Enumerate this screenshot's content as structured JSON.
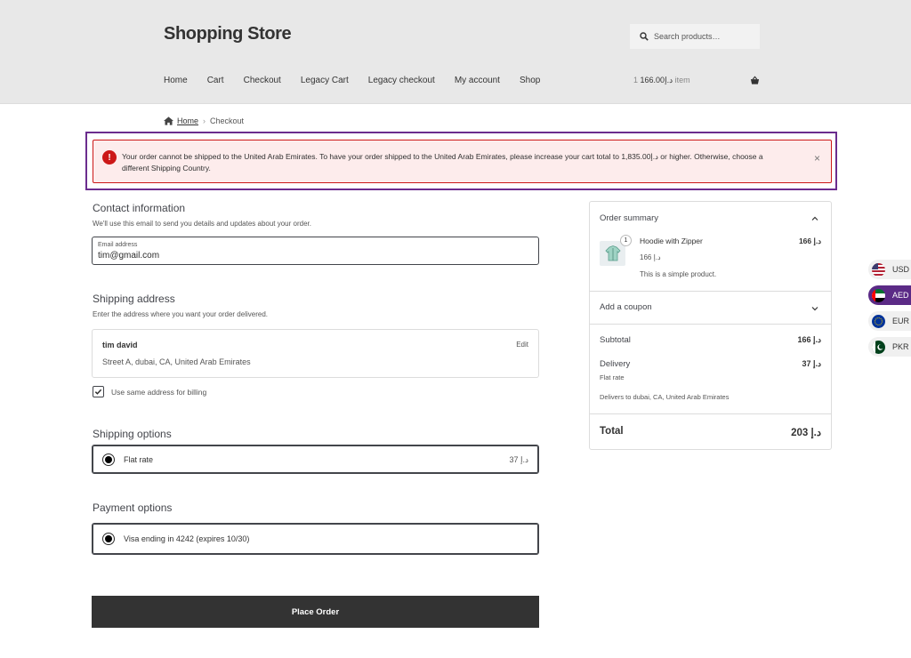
{
  "header": {
    "site_title": "Shopping Store",
    "search_placeholder": "Search products…",
    "nav": [
      "Home",
      "Cart",
      "Checkout",
      "Legacy Cart",
      "Legacy checkout",
      "My account",
      "Shop"
    ],
    "cart_amount": "د.إ166.00",
    "cart_count": "1 item"
  },
  "breadcrumb": {
    "home": "Home",
    "current": "Checkout"
  },
  "notice": {
    "message": "Your order cannot be shipped to the United Arab Emirates. To have your order shipped to the United Arab Emirates, please increase your cart total to 1,835.00د.إ or higher. Otherwise, choose a different Shipping Country.",
    "close": "×"
  },
  "contact": {
    "title": "Contact information",
    "description": "We'll use this email to send you details and updates about your order.",
    "email_label": "Email address",
    "email_value": "tim@gmail.com"
  },
  "shipping_address": {
    "title": "Shipping address",
    "description": "Enter the address where you want your order delivered.",
    "name": "tim david",
    "address": "Street A, dubai, CA, United Arab Emirates",
    "edit": "Edit",
    "same_billing_label": "Use same address for billing",
    "same_billing_checked": true
  },
  "shipping_options": {
    "title": "Shipping options",
    "option_label": "Flat rate",
    "option_price": "37 د.إ"
  },
  "payment_options": {
    "title": "Payment options",
    "option_label": "Visa ending in 4242 (expires 10/30)"
  },
  "place_order": "Place Order",
  "summary": {
    "title": "Order summary",
    "product": {
      "qty": "1",
      "name": "Hoodie with Zipper",
      "line_total": "166 د.إ",
      "price": "166 د.إ",
      "description": "This is a simple product."
    },
    "coupon": "Add a coupon",
    "subtotal_label": "Subtotal",
    "subtotal_value": "166 د.إ",
    "delivery_label": "Delivery",
    "delivery_value": "37 د.إ",
    "delivery_method": "Flat rate",
    "delivers_to": "Delivers to dubai, CA, United Arab Emirates",
    "total_label": "Total",
    "total_value": "203 د.إ"
  },
  "currencies": [
    {
      "code": "USD",
      "active": false
    },
    {
      "code": "AED",
      "active": true
    },
    {
      "code": "EUR",
      "active": false
    },
    {
      "code": "PKR",
      "active": false
    }
  ],
  "colors": {
    "error": "#cc1818",
    "accent": "#5b2a86",
    "button": "#333333"
  }
}
